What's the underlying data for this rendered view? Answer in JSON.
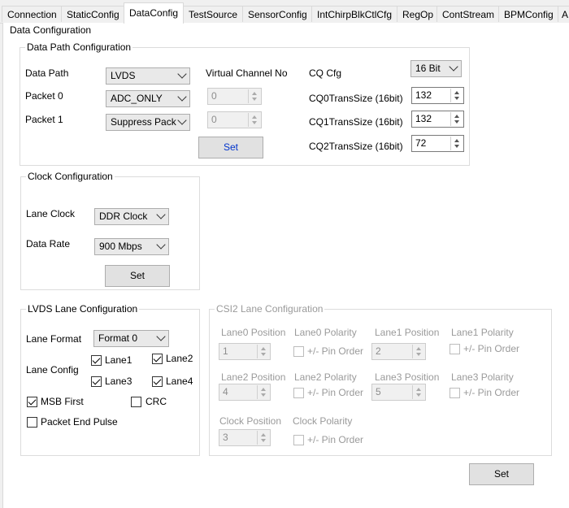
{
  "tabs": [
    {
      "label": "Connection",
      "active": false
    },
    {
      "label": "StaticConfig",
      "active": false
    },
    {
      "label": "DataConfig",
      "active": true
    },
    {
      "label": "TestSource",
      "active": false
    },
    {
      "label": "SensorConfig",
      "active": false
    },
    {
      "label": "IntChirpBlkCtlCfg",
      "active": false
    },
    {
      "label": "RegOp",
      "active": false
    },
    {
      "label": "ContStream",
      "active": false
    },
    {
      "label": "BPMConfig",
      "active": false
    },
    {
      "label": "A",
      "active": false
    }
  ],
  "data_config": {
    "title": "Data Configuration",
    "data_path_group": {
      "title": "Data Path Configuration",
      "data_path_label": "Data Path",
      "data_path_value": "LVDS",
      "packet0_label": "Packet 0",
      "packet0_value": "ADC_ONLY",
      "packet1_label": "Packet 1",
      "packet1_value": "Suppress Pack",
      "vc_label": "Virtual Channel No",
      "vc0_value": "0",
      "vc1_value": "0",
      "set_label": "Set",
      "cq_cfg_label": "CQ Cfg",
      "cq_cfg_value": "16 Bit",
      "cq0_label": "CQ0TransSize (16bit)",
      "cq0_value": "132",
      "cq1_label": "CQ1TransSize (16bit)",
      "cq1_value": "132",
      "cq2_label": "CQ2TransSize (16bit)",
      "cq2_value": "72"
    },
    "clock_group": {
      "title": "Clock Configuration",
      "lane_clock_label": "Lane Clock",
      "lane_clock_value": "DDR Clock",
      "data_rate_label": "Data Rate",
      "data_rate_value": "900 Mbps",
      "set_label": "Set"
    },
    "lvds_group": {
      "title": "LVDS Lane Configuration",
      "lane_format_label": "Lane Format",
      "lane_format_value": "Format 0",
      "lane_config_label": "Lane Config",
      "lane1": {
        "label": "Lane1",
        "checked": true
      },
      "lane2": {
        "label": "Lane2",
        "checked": true
      },
      "lane3": {
        "label": "Lane3",
        "checked": true
      },
      "lane4": {
        "label": "Lane4",
        "checked": true
      },
      "msb_first": {
        "label": "MSB First",
        "checked": true
      },
      "crc": {
        "label": "CRC",
        "checked": false
      },
      "packet_end_pulse": {
        "label": "Packet End Pulse",
        "checked": false
      }
    },
    "csi2_group": {
      "title": "CSI2 Lane Configuration",
      "lane0_position_label": "Lane0 Position",
      "lane0_position_value": "1",
      "lane0_polarity_label": "Lane0 Polarity",
      "lane1_position_label": "Lane1 Position",
      "lane1_position_value": "2",
      "lane1_polarity_label": "Lane1 Polarity",
      "lane2_position_label": "Lane2 Position",
      "lane2_position_value": "4",
      "lane2_polarity_label": "Lane2 Polarity",
      "lane3_position_label": "Lane3 Position",
      "lane3_position_value": "5",
      "lane3_polarity_label": "Lane3 Polarity",
      "clock_position_label": "Clock Position",
      "clock_position_value": "3",
      "clock_polarity_label": "Clock Polarity",
      "pin_order_label": "+/- Pin Order"
    },
    "set_label": "Set"
  }
}
